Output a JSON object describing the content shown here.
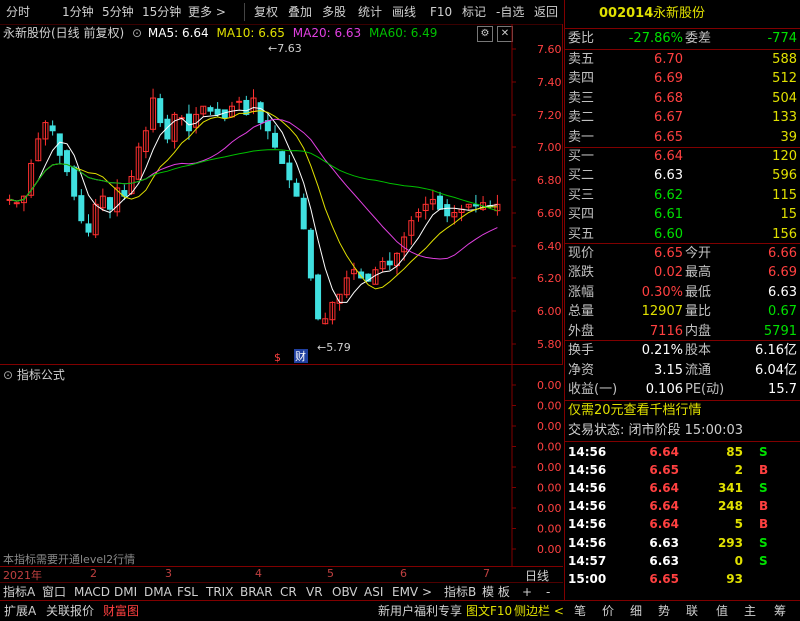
{
  "toolbar": {
    "left_items": [
      "分时",
      "1分钟",
      "5分钟",
      "15分钟",
      "更多 >"
    ],
    "right_items": [
      "复权",
      "叠加",
      "多股",
      "统计",
      "画线",
      "F10",
      "标记",
      "-自选",
      "返回"
    ]
  },
  "chart": {
    "stock_title": "永新股份(日线 前复权)",
    "ma5_label": "MA5: 6.64",
    "ma10_label": "MA10: 6.65",
    "ma20_label": "MA20: 6.63",
    "ma60_label": "MA60: 6.49",
    "ma_colors": {
      "ma5": "#ffffff",
      "ma10": "#e0e000",
      "ma20": "#e040e0",
      "ma60": "#00c000"
    },
    "y_ticks": [
      "7.60",
      "7.40",
      "7.20",
      "7.00",
      "6.80",
      "6.60",
      "6.40",
      "6.20",
      "6.00",
      "5.80"
    ],
    "high_marker": "7.63",
    "low_marker": "5.79",
    "event_marks": [
      "$",
      "财"
    ]
  },
  "indicator": {
    "title": "指标公式",
    "y_ticks": [
      "0.00",
      "0.00",
      "0.00",
      "0.00",
      "0.00",
      "0.00",
      "0.00",
      "0.00",
      "0.00"
    ],
    "notice": "本指标需要开通level2行情"
  },
  "x_axis": {
    "labels": [
      "2021年",
      "2",
      "3",
      "4",
      "5",
      "6",
      "7"
    ],
    "right_label": "日线"
  },
  "indicator_tabs": [
    "指标A",
    "窗口",
    "MACD",
    "DMI",
    "DMA",
    "FSL",
    "TRIX",
    "BRAR",
    "CR",
    "VR",
    "OBV",
    "ASI",
    "EMV",
    ">",
    "指标B",
    "模 板",
    "+",
    "-"
  ],
  "bottom_tabs": {
    "left": [
      "扩展A",
      "关联报价",
      "财富图"
    ],
    "middle": [
      "新用户福利专享",
      "图文F10",
      "侧边栏 <"
    ],
    "right": [
      "笔",
      "价",
      "细",
      "势",
      "联",
      "值",
      "主",
      "筹"
    ]
  },
  "quote": {
    "code": "002014",
    "name": "永新股份",
    "webi_label": "委比",
    "webi_value": "-27.86%",
    "weicha_label": "委差",
    "weicha_value": "-774",
    "asks": [
      {
        "label": "卖五",
        "price": "6.70",
        "vol": "588"
      },
      {
        "label": "卖四",
        "price": "6.69",
        "vol": "512"
      },
      {
        "label": "卖三",
        "price": "6.68",
        "vol": "504"
      },
      {
        "label": "卖二",
        "price": "6.67",
        "vol": "133"
      },
      {
        "label": "卖一",
        "price": "6.65",
        "vol": "39"
      }
    ],
    "bids": [
      {
        "label": "买一",
        "price": "6.64",
        "vol": "120"
      },
      {
        "label": "买二",
        "price": "6.63",
        "vol": "596"
      },
      {
        "label": "买三",
        "price": "6.62",
        "vol": "115"
      },
      {
        "label": "买四",
        "price": "6.61",
        "vol": "15"
      },
      {
        "label": "买五",
        "price": "6.60",
        "vol": "156"
      }
    ],
    "stats": [
      {
        "l1": "现价",
        "v1": "6.65",
        "l2": "今开",
        "v2": "6.66"
      },
      {
        "l1": "涨跌",
        "v1": "0.02",
        "l2": "最高",
        "v2": "6.69"
      },
      {
        "l1": "涨幅",
        "v1": "0.30%",
        "l2": "最低",
        "v2": "6.63"
      },
      {
        "l1": "总量",
        "v1": "12907",
        "l2": "量比",
        "v2": "0.67"
      },
      {
        "l1": "外盘",
        "v1": "7116",
        "l2": "内盘",
        "v2": "5791"
      }
    ],
    "fin": [
      {
        "l1": "换手",
        "v1": "0.21%",
        "l2": "股本",
        "v2": "6.16亿"
      },
      {
        "l1": "净资",
        "v1": "3.15",
        "l2": "流通",
        "v2": "6.04亿"
      },
      {
        "l1": "收益(一)",
        "v1": "0.106",
        "l2": "PE(动)",
        "v2": "15.7"
      }
    ],
    "promo": "仅需20元查看千档行情",
    "trade_status": "交易状态: 闭市阶段 15:00:03",
    "ticks": [
      {
        "time": "14:56",
        "price": "6.64",
        "vol": "85",
        "side": "S"
      },
      {
        "time": "14:56",
        "price": "6.65",
        "vol": "2",
        "side": "B"
      },
      {
        "time": "14:56",
        "price": "6.64",
        "vol": "341",
        "side": "S"
      },
      {
        "time": "14:56",
        "price": "6.64",
        "vol": "248",
        "side": "B"
      },
      {
        "time": "14:56",
        "price": "6.64",
        "vol": "5",
        "side": "B"
      },
      {
        "time": "14:56",
        "price": "6.63",
        "vol": "293",
        "side": "S"
      },
      {
        "time": "14:57",
        "price": "6.63",
        "vol": "0",
        "side": "S"
      },
      {
        "time": "15:00",
        "price": "6.65",
        "vol": "93",
        "side": ""
      }
    ]
  }
}
